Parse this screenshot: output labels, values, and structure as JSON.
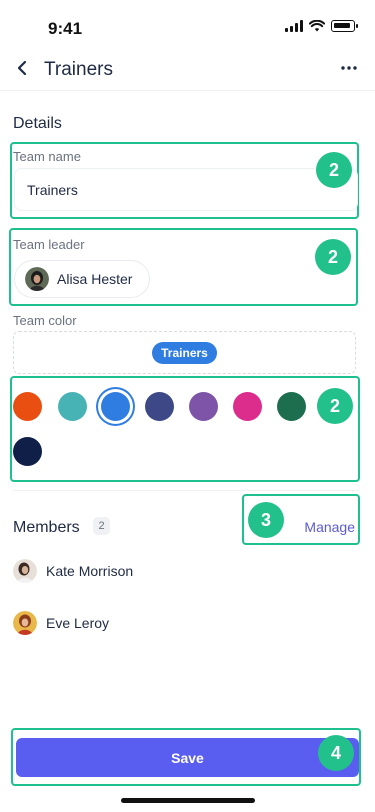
{
  "status_bar": {
    "time": "9:41"
  },
  "nav": {
    "title": "Trainers",
    "back_icon": "chevron-left-icon",
    "more_icon": "more-horizontal-icon"
  },
  "details": {
    "title": "Details",
    "team_name": {
      "label": "Team name",
      "value": "Trainers"
    },
    "team_leader": {
      "label": "Team leader",
      "name": "Alisa Hester"
    },
    "team_color": {
      "label": "Team color",
      "preview": "Trainers",
      "selected": "#2f7de1"
    }
  },
  "colors": [
    "#ea4f12",
    "#48b3b4",
    "#2f7de1",
    "#3d4886",
    "#7d54a8",
    "#dc2d8d",
    "#1d6e4f",
    "#0f1f47"
  ],
  "members": {
    "title": "Members",
    "count": "2",
    "manage": "Manage",
    "list": [
      {
        "name": "Kate Morrison"
      },
      {
        "name": "Eve Leroy"
      }
    ]
  },
  "badges": {
    "team_name": "2",
    "team_leader": "2",
    "colors": "2",
    "manage": "3",
    "save": "4"
  },
  "save_label": "Save",
  "accent": {
    "highlight": "#1fc08f",
    "badge": "#22c08a",
    "primary": "#5a5ef0"
  }
}
